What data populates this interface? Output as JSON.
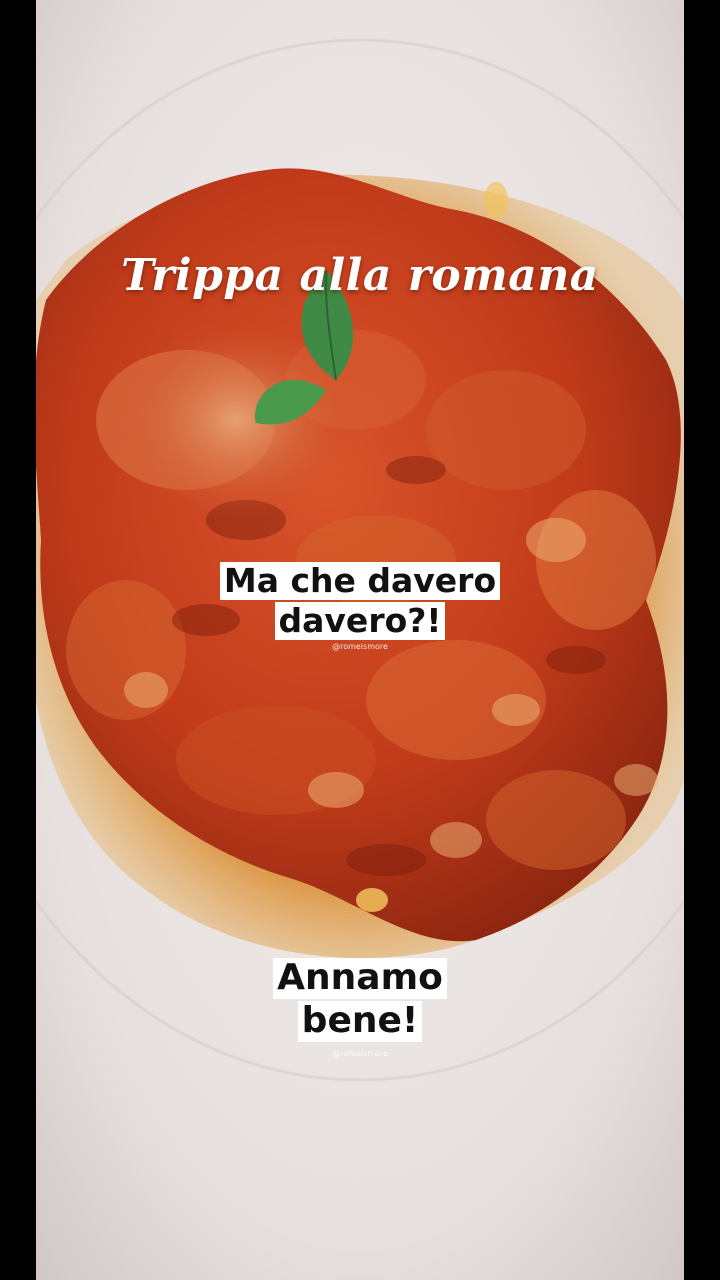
{
  "photo": {
    "subject": "tripe-dish-photo",
    "colors": {
      "plate": "#e8e2e0",
      "sauce": "#c43d1c",
      "oil": "#e39a3a",
      "mint": "#3f8a45",
      "side_bars": "#000000"
    }
  },
  "overlay": {
    "title": "Trippa alla romana",
    "caption_1": {
      "line_1": "Ma che davero",
      "line_2": "davero?!"
    },
    "watermark_1": "@romeismore",
    "caption_2": {
      "line_1": "Annamo",
      "line_2": "bene!"
    },
    "watermark_2": "@romeismore"
  }
}
